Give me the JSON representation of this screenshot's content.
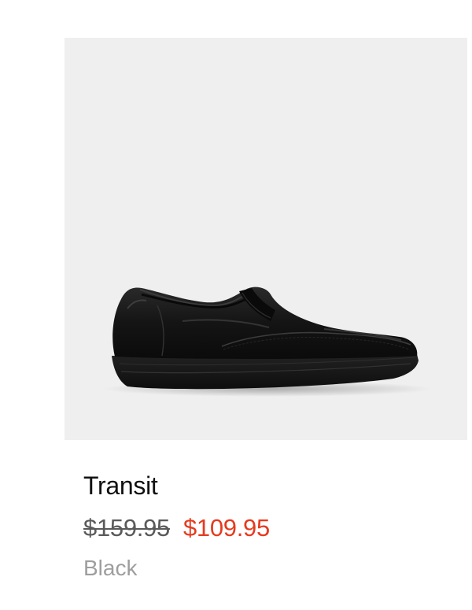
{
  "product": {
    "image": {
      "icon": "slip-on-leather-shoe",
      "background_color": "#efefef"
    },
    "name": "Transit",
    "original_price": "$159.95",
    "sale_price": "$109.95",
    "color": "Black"
  },
  "colors": {
    "sale_price": "#e53b1f",
    "name": "#111111",
    "original_price": "#5a5a5a",
    "color_label": "#9e9e9e"
  }
}
